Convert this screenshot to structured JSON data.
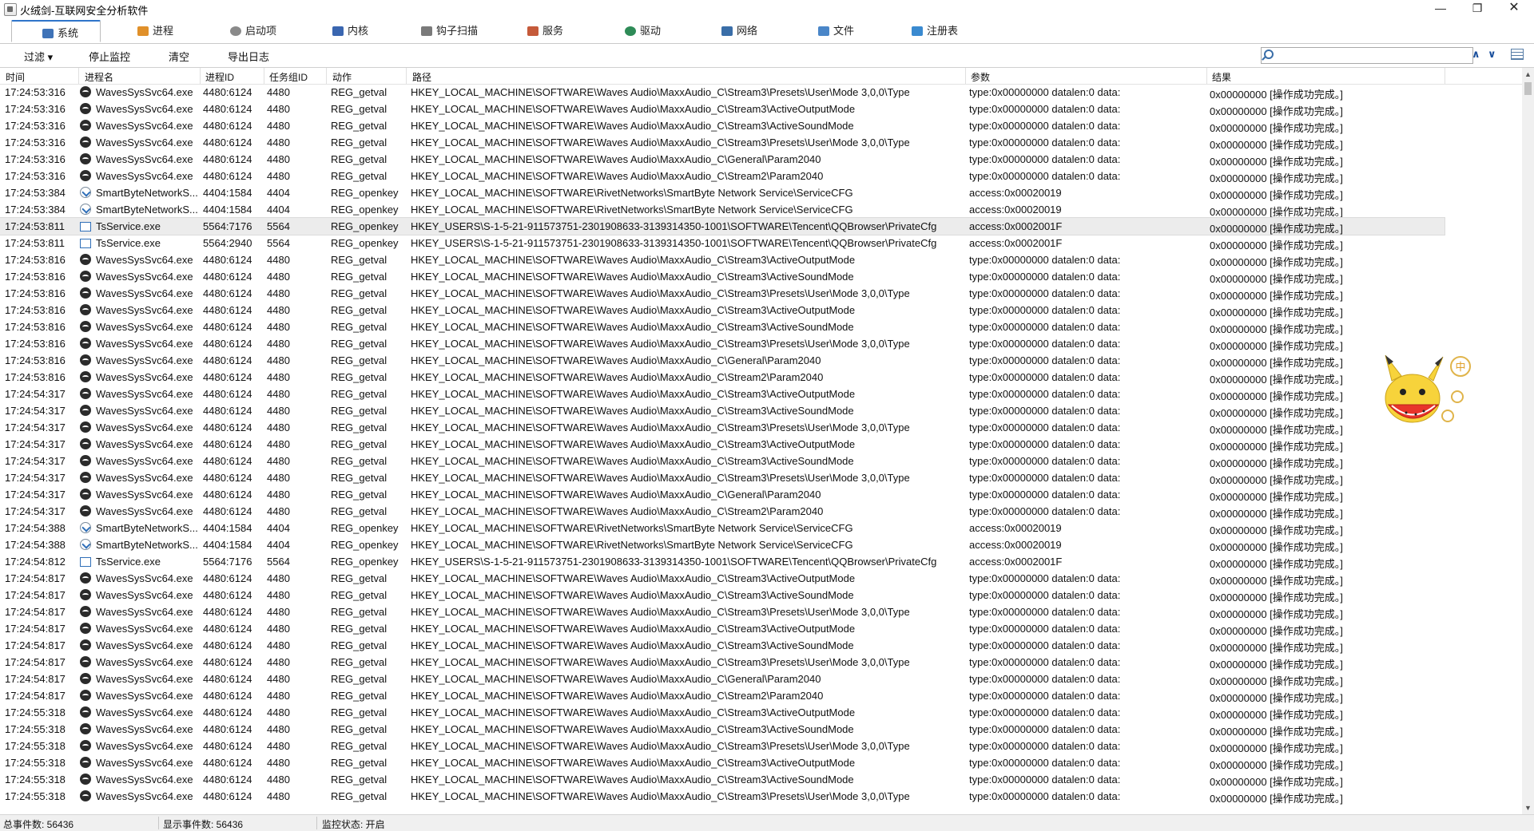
{
  "window": {
    "title": "火绒剑-互联网安全分析软件"
  },
  "tabs": [
    {
      "label": "系统",
      "color": "#3f73b8"
    },
    {
      "label": "进程",
      "color": "#e0902a"
    },
    {
      "label": "启动项",
      "color": "#8a8a8a"
    },
    {
      "label": "内核",
      "color": "#3a66b0"
    },
    {
      "label": "钩子扫描",
      "color": "#7a7a7a"
    },
    {
      "label": "服务",
      "color": "#c55a3a"
    },
    {
      "label": "驱动",
      "color": "#2e8b57"
    },
    {
      "label": "网络",
      "color": "#3a6ea8"
    },
    {
      "label": "文件",
      "color": "#4a86c8"
    },
    {
      "label": "注册表",
      "color": "#3a8ad0"
    }
  ],
  "toolbar": {
    "filter": "过滤 ▾",
    "stop": "停止监控",
    "clear": "清空",
    "export": "导出日志",
    "search_value": ""
  },
  "columns": {
    "time": "时间",
    "name": "进程名",
    "pid": "进程ID",
    "tid": "任务组ID",
    "action": "动作",
    "path": "路径",
    "param": "参数",
    "result": "结果"
  },
  "rows": [
    {
      "t": "17:24:53:316",
      "n": "WavesSysSvc64.exe",
      "i": "waves",
      "p": "4480:6124",
      "g": "4480",
      "a": "REG_getval",
      "path": "HKEY_LOCAL_MACHINE\\SOFTWARE\\Waves Audio\\MaxxAudio_C\\Stream3\\Presets\\User\\Mode 3,0,0\\Type",
      "pa": "type:0x00000000 datalen:0 data:",
      "r": "0x00000000 [操作成功完成。]"
    },
    {
      "t": "17:24:53:316",
      "n": "WavesSysSvc64.exe",
      "i": "waves",
      "p": "4480:6124",
      "g": "4480",
      "a": "REG_getval",
      "path": "HKEY_LOCAL_MACHINE\\SOFTWARE\\Waves Audio\\MaxxAudio_C\\Stream3\\ActiveOutputMode",
      "pa": "type:0x00000000 datalen:0 data:",
      "r": "0x00000000 [操作成功完成。]"
    },
    {
      "t": "17:24:53:316",
      "n": "WavesSysSvc64.exe",
      "i": "waves",
      "p": "4480:6124",
      "g": "4480",
      "a": "REG_getval",
      "path": "HKEY_LOCAL_MACHINE\\SOFTWARE\\Waves Audio\\MaxxAudio_C\\Stream3\\ActiveSoundMode",
      "pa": "type:0x00000000 datalen:0 data:",
      "r": "0x00000000 [操作成功完成。]"
    },
    {
      "t": "17:24:53:316",
      "n": "WavesSysSvc64.exe",
      "i": "waves",
      "p": "4480:6124",
      "g": "4480",
      "a": "REG_getval",
      "path": "HKEY_LOCAL_MACHINE\\SOFTWARE\\Waves Audio\\MaxxAudio_C\\Stream3\\Presets\\User\\Mode 3,0,0\\Type",
      "pa": "type:0x00000000 datalen:0 data:",
      "r": "0x00000000 [操作成功完成。]"
    },
    {
      "t": "17:24:53:316",
      "n": "WavesSysSvc64.exe",
      "i": "waves",
      "p": "4480:6124",
      "g": "4480",
      "a": "REG_getval",
      "path": "HKEY_LOCAL_MACHINE\\SOFTWARE\\Waves Audio\\MaxxAudio_C\\General\\Param2040",
      "pa": "type:0x00000000 datalen:0 data:",
      "r": "0x00000000 [操作成功完成。]"
    },
    {
      "t": "17:24:53:316",
      "n": "WavesSysSvc64.exe",
      "i": "waves",
      "p": "4480:6124",
      "g": "4480",
      "a": "REG_getval",
      "path": "HKEY_LOCAL_MACHINE\\SOFTWARE\\Waves Audio\\MaxxAudio_C\\Stream2\\Param2040",
      "pa": "type:0x00000000 datalen:0 data:",
      "r": "0x00000000 [操作成功完成。]"
    },
    {
      "t": "17:24:53:384",
      "n": "SmartByteNetworkS...",
      "i": "smart",
      "p": "4404:1584",
      "g": "4404",
      "a": "REG_openkey",
      "path": "HKEY_LOCAL_MACHINE\\SOFTWARE\\RivetNetworks\\SmartByte Network Service\\ServiceCFG",
      "pa": "access:0x00020019",
      "r": "0x00000000 [操作成功完成。]"
    },
    {
      "t": "17:24:53:384",
      "n": "SmartByteNetworkS...",
      "i": "smart",
      "p": "4404:1584",
      "g": "4404",
      "a": "REG_openkey",
      "path": "HKEY_LOCAL_MACHINE\\SOFTWARE\\RivetNetworks\\SmartByte Network Service\\ServiceCFG",
      "pa": "access:0x00020019",
      "r": "0x00000000 [操作成功完成。]"
    },
    {
      "t": "17:24:53:811",
      "n": "TsService.exe",
      "i": "ts",
      "p": "5564:7176",
      "g": "5564",
      "a": "REG_openkey",
      "path": "HKEY_USERS\\S-1-5-21-911573751-2301908633-3139314350-1001\\SOFTWARE\\Tencent\\QQBrowser\\PrivateCfg",
      "pa": "access:0x0002001F",
      "r": "0x00000000 [操作成功完成。]",
      "hl": true
    },
    {
      "t": "17:24:53:811",
      "n": "TsService.exe",
      "i": "ts",
      "p": "5564:2940",
      "g": "5564",
      "a": "REG_openkey",
      "path": "HKEY_USERS\\S-1-5-21-911573751-2301908633-3139314350-1001\\SOFTWARE\\Tencent\\QQBrowser\\PrivateCfg",
      "pa": "access:0x0002001F",
      "r": "0x00000000 [操作成功完成。]"
    },
    {
      "t": "17:24:53:816",
      "n": "WavesSysSvc64.exe",
      "i": "waves",
      "p": "4480:6124",
      "g": "4480",
      "a": "REG_getval",
      "path": "HKEY_LOCAL_MACHINE\\SOFTWARE\\Waves Audio\\MaxxAudio_C\\Stream3\\ActiveOutputMode",
      "pa": "type:0x00000000 datalen:0 data:",
      "r": "0x00000000 [操作成功完成。]"
    },
    {
      "t": "17:24:53:816",
      "n": "WavesSysSvc64.exe",
      "i": "waves",
      "p": "4480:6124",
      "g": "4480",
      "a": "REG_getval",
      "path": "HKEY_LOCAL_MACHINE\\SOFTWARE\\Waves Audio\\MaxxAudio_C\\Stream3\\ActiveSoundMode",
      "pa": "type:0x00000000 datalen:0 data:",
      "r": "0x00000000 [操作成功完成。]"
    },
    {
      "t": "17:24:53:816",
      "n": "WavesSysSvc64.exe",
      "i": "waves",
      "p": "4480:6124",
      "g": "4480",
      "a": "REG_getval",
      "path": "HKEY_LOCAL_MACHINE\\SOFTWARE\\Waves Audio\\MaxxAudio_C\\Stream3\\Presets\\User\\Mode 3,0,0\\Type",
      "pa": "type:0x00000000 datalen:0 data:",
      "r": "0x00000000 [操作成功完成。]"
    },
    {
      "t": "17:24:53:816",
      "n": "WavesSysSvc64.exe",
      "i": "waves",
      "p": "4480:6124",
      "g": "4480",
      "a": "REG_getval",
      "path": "HKEY_LOCAL_MACHINE\\SOFTWARE\\Waves Audio\\MaxxAudio_C\\Stream3\\ActiveOutputMode",
      "pa": "type:0x00000000 datalen:0 data:",
      "r": "0x00000000 [操作成功完成。]"
    },
    {
      "t": "17:24:53:816",
      "n": "WavesSysSvc64.exe",
      "i": "waves",
      "p": "4480:6124",
      "g": "4480",
      "a": "REG_getval",
      "path": "HKEY_LOCAL_MACHINE\\SOFTWARE\\Waves Audio\\MaxxAudio_C\\Stream3\\ActiveSoundMode",
      "pa": "type:0x00000000 datalen:0 data:",
      "r": "0x00000000 [操作成功完成。]"
    },
    {
      "t": "17:24:53:816",
      "n": "WavesSysSvc64.exe",
      "i": "waves",
      "p": "4480:6124",
      "g": "4480",
      "a": "REG_getval",
      "path": "HKEY_LOCAL_MACHINE\\SOFTWARE\\Waves Audio\\MaxxAudio_C\\Stream3\\Presets\\User\\Mode 3,0,0\\Type",
      "pa": "type:0x00000000 datalen:0 data:",
      "r": "0x00000000 [操作成功完成。]"
    },
    {
      "t": "17:24:53:816",
      "n": "WavesSysSvc64.exe",
      "i": "waves",
      "p": "4480:6124",
      "g": "4480",
      "a": "REG_getval",
      "path": "HKEY_LOCAL_MACHINE\\SOFTWARE\\Waves Audio\\MaxxAudio_C\\General\\Param2040",
      "pa": "type:0x00000000 datalen:0 data:",
      "r": "0x00000000 [操作成功完成。]"
    },
    {
      "t": "17:24:53:816",
      "n": "WavesSysSvc64.exe",
      "i": "waves",
      "p": "4480:6124",
      "g": "4480",
      "a": "REG_getval",
      "path": "HKEY_LOCAL_MACHINE\\SOFTWARE\\Waves Audio\\MaxxAudio_C\\Stream2\\Param2040",
      "pa": "type:0x00000000 datalen:0 data:",
      "r": "0x00000000 [操作成功完成。]"
    },
    {
      "t": "17:24:54:317",
      "n": "WavesSysSvc64.exe",
      "i": "waves",
      "p": "4480:6124",
      "g": "4480",
      "a": "REG_getval",
      "path": "HKEY_LOCAL_MACHINE\\SOFTWARE\\Waves Audio\\MaxxAudio_C\\Stream3\\ActiveOutputMode",
      "pa": "type:0x00000000 datalen:0 data:",
      "r": "0x00000000 [操作成功完成。]"
    },
    {
      "t": "17:24:54:317",
      "n": "WavesSysSvc64.exe",
      "i": "waves",
      "p": "4480:6124",
      "g": "4480",
      "a": "REG_getval",
      "path": "HKEY_LOCAL_MACHINE\\SOFTWARE\\Waves Audio\\MaxxAudio_C\\Stream3\\ActiveSoundMode",
      "pa": "type:0x00000000 datalen:0 data:",
      "r": "0x00000000 [操作成功完成。]"
    },
    {
      "t": "17:24:54:317",
      "n": "WavesSysSvc64.exe",
      "i": "waves",
      "p": "4480:6124",
      "g": "4480",
      "a": "REG_getval",
      "path": "HKEY_LOCAL_MACHINE\\SOFTWARE\\Waves Audio\\MaxxAudio_C\\Stream3\\Presets\\User\\Mode 3,0,0\\Type",
      "pa": "type:0x00000000 datalen:0 data:",
      "r": "0x00000000 [操作成功完成。]"
    },
    {
      "t": "17:24:54:317",
      "n": "WavesSysSvc64.exe",
      "i": "waves",
      "p": "4480:6124",
      "g": "4480",
      "a": "REG_getval",
      "path": "HKEY_LOCAL_MACHINE\\SOFTWARE\\Waves Audio\\MaxxAudio_C\\Stream3\\ActiveOutputMode",
      "pa": "type:0x00000000 datalen:0 data:",
      "r": "0x00000000 [操作成功完成。]"
    },
    {
      "t": "17:24:54:317",
      "n": "WavesSysSvc64.exe",
      "i": "waves",
      "p": "4480:6124",
      "g": "4480",
      "a": "REG_getval",
      "path": "HKEY_LOCAL_MACHINE\\SOFTWARE\\Waves Audio\\MaxxAudio_C\\Stream3\\ActiveSoundMode",
      "pa": "type:0x00000000 datalen:0 data:",
      "r": "0x00000000 [操作成功完成。]"
    },
    {
      "t": "17:24:54:317",
      "n": "WavesSysSvc64.exe",
      "i": "waves",
      "p": "4480:6124",
      "g": "4480",
      "a": "REG_getval",
      "path": "HKEY_LOCAL_MACHINE\\SOFTWARE\\Waves Audio\\MaxxAudio_C\\Stream3\\Presets\\User\\Mode 3,0,0\\Type",
      "pa": "type:0x00000000 datalen:0 data:",
      "r": "0x00000000 [操作成功完成。]"
    },
    {
      "t": "17:24:54:317",
      "n": "WavesSysSvc64.exe",
      "i": "waves",
      "p": "4480:6124",
      "g": "4480",
      "a": "REG_getval",
      "path": "HKEY_LOCAL_MACHINE\\SOFTWARE\\Waves Audio\\MaxxAudio_C\\General\\Param2040",
      "pa": "type:0x00000000 datalen:0 data:",
      "r": "0x00000000 [操作成功完成。]"
    },
    {
      "t": "17:24:54:317",
      "n": "WavesSysSvc64.exe",
      "i": "waves",
      "p": "4480:6124",
      "g": "4480",
      "a": "REG_getval",
      "path": "HKEY_LOCAL_MACHINE\\SOFTWARE\\Waves Audio\\MaxxAudio_C\\Stream2\\Param2040",
      "pa": "type:0x00000000 datalen:0 data:",
      "r": "0x00000000 [操作成功完成。]"
    },
    {
      "t": "17:24:54:388",
      "n": "SmartByteNetworkS...",
      "i": "smart",
      "p": "4404:1584",
      "g": "4404",
      "a": "REG_openkey",
      "path": "HKEY_LOCAL_MACHINE\\SOFTWARE\\RivetNetworks\\SmartByte Network Service\\ServiceCFG",
      "pa": "access:0x00020019",
      "r": "0x00000000 [操作成功完成。]"
    },
    {
      "t": "17:24:54:388",
      "n": "SmartByteNetworkS...",
      "i": "smart",
      "p": "4404:1584",
      "g": "4404",
      "a": "REG_openkey",
      "path": "HKEY_LOCAL_MACHINE\\SOFTWARE\\RivetNetworks\\SmartByte Network Service\\ServiceCFG",
      "pa": "access:0x00020019",
      "r": "0x00000000 [操作成功完成。]"
    },
    {
      "t": "17:24:54:812",
      "n": "TsService.exe",
      "i": "ts",
      "p": "5564:7176",
      "g": "5564",
      "a": "REG_openkey",
      "path": "HKEY_USERS\\S-1-5-21-911573751-2301908633-3139314350-1001\\SOFTWARE\\Tencent\\QQBrowser\\PrivateCfg",
      "pa": "access:0x0002001F",
      "r": "0x00000000 [操作成功完成。]"
    },
    {
      "t": "17:24:54:817",
      "n": "WavesSysSvc64.exe",
      "i": "waves",
      "p": "4480:6124",
      "g": "4480",
      "a": "REG_getval",
      "path": "HKEY_LOCAL_MACHINE\\SOFTWARE\\Waves Audio\\MaxxAudio_C\\Stream3\\ActiveOutputMode",
      "pa": "type:0x00000000 datalen:0 data:",
      "r": "0x00000000 [操作成功完成。]"
    },
    {
      "t": "17:24:54:817",
      "n": "WavesSysSvc64.exe",
      "i": "waves",
      "p": "4480:6124",
      "g": "4480",
      "a": "REG_getval",
      "path": "HKEY_LOCAL_MACHINE\\SOFTWARE\\Waves Audio\\MaxxAudio_C\\Stream3\\ActiveSoundMode",
      "pa": "type:0x00000000 datalen:0 data:",
      "r": "0x00000000 [操作成功完成。]"
    },
    {
      "t": "17:24:54:817",
      "n": "WavesSysSvc64.exe",
      "i": "waves",
      "p": "4480:6124",
      "g": "4480",
      "a": "REG_getval",
      "path": "HKEY_LOCAL_MACHINE\\SOFTWARE\\Waves Audio\\MaxxAudio_C\\Stream3\\Presets\\User\\Mode 3,0,0\\Type",
      "pa": "type:0x00000000 datalen:0 data:",
      "r": "0x00000000 [操作成功完成。]"
    },
    {
      "t": "17:24:54:817",
      "n": "WavesSysSvc64.exe",
      "i": "waves",
      "p": "4480:6124",
      "g": "4480",
      "a": "REG_getval",
      "path": "HKEY_LOCAL_MACHINE\\SOFTWARE\\Waves Audio\\MaxxAudio_C\\Stream3\\ActiveOutputMode",
      "pa": "type:0x00000000 datalen:0 data:",
      "r": "0x00000000 [操作成功完成。]"
    },
    {
      "t": "17:24:54:817",
      "n": "WavesSysSvc64.exe",
      "i": "waves",
      "p": "4480:6124",
      "g": "4480",
      "a": "REG_getval",
      "path": "HKEY_LOCAL_MACHINE\\SOFTWARE\\Waves Audio\\MaxxAudio_C\\Stream3\\ActiveSoundMode",
      "pa": "type:0x00000000 datalen:0 data:",
      "r": "0x00000000 [操作成功完成。]"
    },
    {
      "t": "17:24:54:817",
      "n": "WavesSysSvc64.exe",
      "i": "waves",
      "p": "4480:6124",
      "g": "4480",
      "a": "REG_getval",
      "path": "HKEY_LOCAL_MACHINE\\SOFTWARE\\Waves Audio\\MaxxAudio_C\\Stream3\\Presets\\User\\Mode 3,0,0\\Type",
      "pa": "type:0x00000000 datalen:0 data:",
      "r": "0x00000000 [操作成功完成。]"
    },
    {
      "t": "17:24:54:817",
      "n": "WavesSysSvc64.exe",
      "i": "waves",
      "p": "4480:6124",
      "g": "4480",
      "a": "REG_getval",
      "path": "HKEY_LOCAL_MACHINE\\SOFTWARE\\Waves Audio\\MaxxAudio_C\\General\\Param2040",
      "pa": "type:0x00000000 datalen:0 data:",
      "r": "0x00000000 [操作成功完成。]"
    },
    {
      "t": "17:24:54:817",
      "n": "WavesSysSvc64.exe",
      "i": "waves",
      "p": "4480:6124",
      "g": "4480",
      "a": "REG_getval",
      "path": "HKEY_LOCAL_MACHINE\\SOFTWARE\\Waves Audio\\MaxxAudio_C\\Stream2\\Param2040",
      "pa": "type:0x00000000 datalen:0 data:",
      "r": "0x00000000 [操作成功完成。]"
    },
    {
      "t": "17:24:55:318",
      "n": "WavesSysSvc64.exe",
      "i": "waves",
      "p": "4480:6124",
      "g": "4480",
      "a": "REG_getval",
      "path": "HKEY_LOCAL_MACHINE\\SOFTWARE\\Waves Audio\\MaxxAudio_C\\Stream3\\ActiveOutputMode",
      "pa": "type:0x00000000 datalen:0 data:",
      "r": "0x00000000 [操作成功完成。]"
    },
    {
      "t": "17:24:55:318",
      "n": "WavesSysSvc64.exe",
      "i": "waves",
      "p": "4480:6124",
      "g": "4480",
      "a": "REG_getval",
      "path": "HKEY_LOCAL_MACHINE\\SOFTWARE\\Waves Audio\\MaxxAudio_C\\Stream3\\ActiveSoundMode",
      "pa": "type:0x00000000 datalen:0 data:",
      "r": "0x00000000 [操作成功完成。]"
    },
    {
      "t": "17:24:55:318",
      "n": "WavesSysSvc64.exe",
      "i": "waves",
      "p": "4480:6124",
      "g": "4480",
      "a": "REG_getval",
      "path": "HKEY_LOCAL_MACHINE\\SOFTWARE\\Waves Audio\\MaxxAudio_C\\Stream3\\Presets\\User\\Mode 3,0,0\\Type",
      "pa": "type:0x00000000 datalen:0 data:",
      "r": "0x00000000 [操作成功完成。]"
    },
    {
      "t": "17:24:55:318",
      "n": "WavesSysSvc64.exe",
      "i": "waves",
      "p": "4480:6124",
      "g": "4480",
      "a": "REG_getval",
      "path": "HKEY_LOCAL_MACHINE\\SOFTWARE\\Waves Audio\\MaxxAudio_C\\Stream3\\ActiveOutputMode",
      "pa": "type:0x00000000 datalen:0 data:",
      "r": "0x00000000 [操作成功完成。]"
    },
    {
      "t": "17:24:55:318",
      "n": "WavesSysSvc64.exe",
      "i": "waves",
      "p": "4480:6124",
      "g": "4480",
      "a": "REG_getval",
      "path": "HKEY_LOCAL_MACHINE\\SOFTWARE\\Waves Audio\\MaxxAudio_C\\Stream3\\ActiveSoundMode",
      "pa": "type:0x00000000 datalen:0 data:",
      "r": "0x00000000 [操作成功完成。]"
    },
    {
      "t": "17:24:55:318",
      "n": "WavesSysSvc64.exe",
      "i": "waves",
      "p": "4480:6124",
      "g": "4480",
      "a": "REG_getval",
      "path": "HKEY_LOCAL_MACHINE\\SOFTWARE\\Waves Audio\\MaxxAudio_C\\Stream3\\Presets\\User\\Mode 3,0,0\\Type",
      "pa": "type:0x00000000 datalen:0 data:",
      "r": "0x00000000 [操作成功完成。]"
    }
  ],
  "status": {
    "total": "总事件数: 56436",
    "shown": "显示事件数: 56436",
    "monitor": "监控状态: 开启"
  },
  "mascot": {
    "badge": "中"
  }
}
